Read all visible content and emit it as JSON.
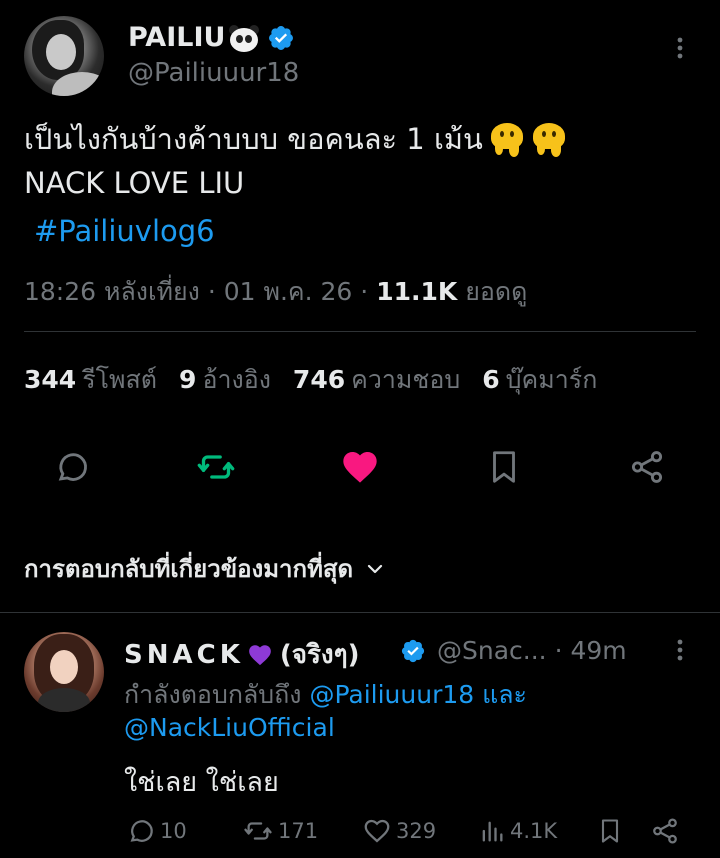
{
  "post": {
    "display_name": "PAILIU",
    "handle": "@Pailiuuur18",
    "text_line1": "เป็นไงกันบ้างค้าบบบ ขอคนละ 1 เม้น",
    "text_line2": "NACK LOVE LIU",
    "hashtag": "#Pailiuvlog6",
    "time": "18:26 หลังเที่ยง · 01 พ.ค. 26 · ",
    "views_count": "11.1K",
    "views_label": " ยอดดู",
    "stats": {
      "reposts_count": "344",
      "reposts_label": "รีโพสต์",
      "quotes_count": "9",
      "quotes_label": "อ้างอิง",
      "likes_count": "746",
      "likes_label": "ความชอบ",
      "bookmarks_count": "6",
      "bookmarks_label": "บุ๊คมาร์ก"
    },
    "accent": {
      "blue": "#1d9bf0",
      "green": "#00ba7c",
      "pink": "#f91880",
      "muted": "#71767b"
    }
  },
  "replies_sort_label": "การตอบกลับที่เกี่ยวข้องมากที่สุด",
  "reply": {
    "name_spaced": "SNACK",
    "name_suffix": "(จริงๆ)",
    "handle_time": "@Snac...  · 49m",
    "replying_prefix": "กำลังตอบกลับถึง ",
    "mention1": "@Pailiuuur18",
    "and_word": " และ",
    "mention2": "@NackLiuOfficial",
    "text": "ใช่เลย ใช่เลย",
    "replies": "10",
    "reposts": "171",
    "likes": "329",
    "views": "4.1K"
  }
}
